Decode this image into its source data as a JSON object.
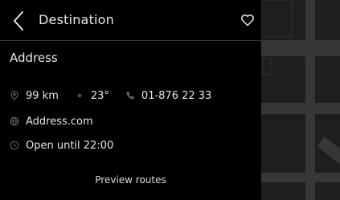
{
  "header": {
    "back_icon": "chevron-left-icon",
    "title": "Destination",
    "favorite_icon": "heart-outline-icon"
  },
  "place": {
    "name": "Address",
    "distance": "99 km",
    "temperature": "23°",
    "phone": "01-876 22 33",
    "website": "Address.com",
    "hours": "Open until 22:00"
  },
  "icons": {
    "distance": "location-pin-icon",
    "temperature": "weather-icon",
    "phone": "phone-icon",
    "website": "globe-icon",
    "hours": "clock-icon"
  },
  "actions": {
    "preview_routes": "Preview routes"
  },
  "colors": {
    "panel_bg": "#000000",
    "map_bg": "#1f1f1f",
    "map_road": "#3a3a3a",
    "text": "#e6e6e6",
    "icon_dim": "#6a6a6a"
  }
}
